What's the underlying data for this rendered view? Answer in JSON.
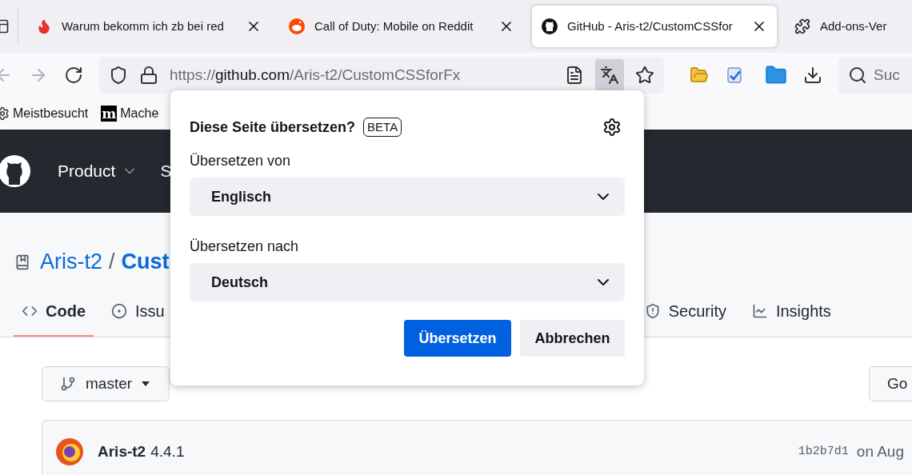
{
  "tabs": [
    {
      "kind": "fire",
      "title": "Warum bekomm ich zb bei red",
      "selected": false
    },
    {
      "kind": "reddit",
      "title": "Call of Duty: Mobile on Reddit",
      "selected": false
    },
    {
      "kind": "github",
      "title": "GitHub - Aris-t2/CustomCSSfor",
      "selected": true
    },
    {
      "kind": "extension",
      "title": "Add-ons-Ver",
      "selected": false
    }
  ],
  "toolbar": {
    "url_scheme": "https://",
    "url_host": "github.com",
    "url_path": "/Aris-t2/CustomCSSforFx",
    "translate_active": true,
    "search_placeholder": "Suc"
  },
  "bookmarks": [
    {
      "kind": "gear",
      "label": "Meistbesucht"
    },
    {
      "kind": "logo",
      "logo_text": "m",
      "label": "Mache"
    }
  ],
  "github": {
    "nav": [
      "Product",
      "S"
    ],
    "owner": "Aris-t2",
    "separator": "/",
    "repo": "Cust",
    "repo_tabs": [
      {
        "kind": "code",
        "label": "Code",
        "selected": true
      },
      {
        "kind": "issues",
        "label": "Issu",
        "selected": false
      },
      {
        "kind": "security",
        "label": "Security",
        "selected": false
      },
      {
        "kind": "insights",
        "label": "Insights",
        "selected": false
      }
    ],
    "branch": "master",
    "go": "Go",
    "commit": {
      "author": "Aris-t2",
      "message": "4.4.1",
      "hash": "1b2b7d1",
      "date": "on Aug"
    }
  },
  "popup": {
    "title": "Diese Seite übersetzen?",
    "badge": "BETA",
    "from_label": "Übersetzen von",
    "from_value": "Englisch",
    "to_label": "Übersetzen nach",
    "to_value": "Deutsch",
    "primary": "Übersetzen",
    "secondary": "Abbrechen"
  }
}
